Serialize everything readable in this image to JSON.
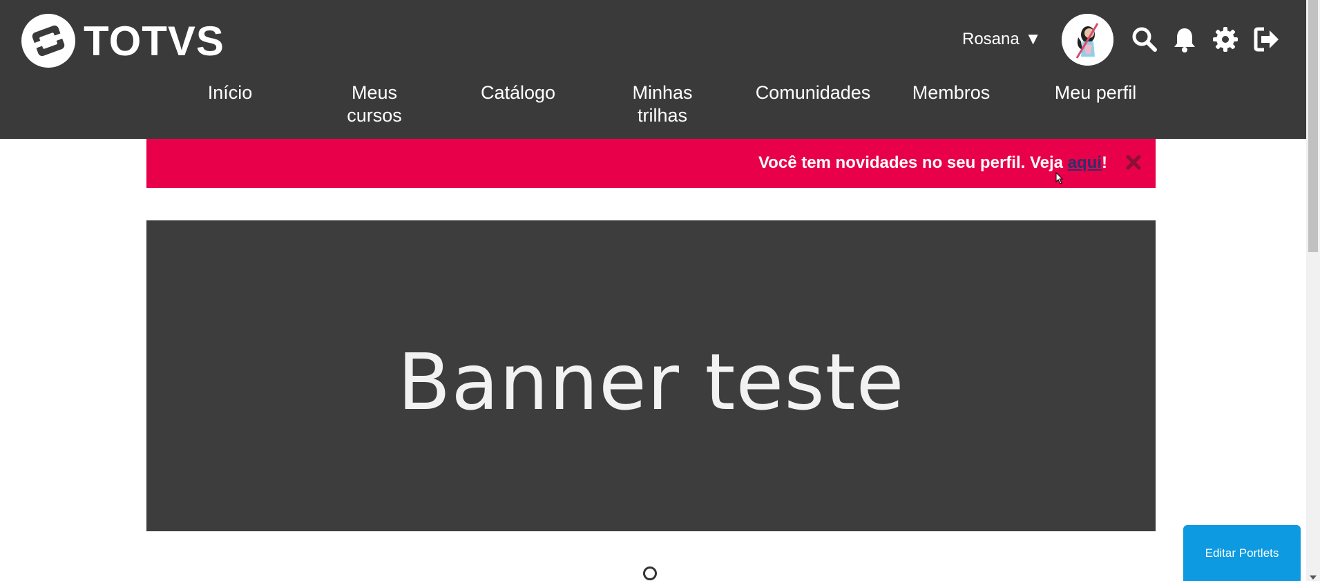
{
  "brand": {
    "logo_text": "TOTVS"
  },
  "header": {
    "user_name": "Rosana",
    "user_caret": "▼",
    "icons": [
      "search-icon",
      "bell-icon",
      "gear-icon",
      "logout-icon"
    ]
  },
  "nav": {
    "items": [
      {
        "label": "Início"
      },
      {
        "label": "Meus cursos"
      },
      {
        "label": "Catálogo"
      },
      {
        "label": "Minhas trilhas"
      },
      {
        "label": "Comunidades"
      },
      {
        "label": "Membros"
      },
      {
        "label": "Meu perfil"
      }
    ]
  },
  "alert": {
    "text": "Você tem novidades no seu perfil. Veja ",
    "link_text": "aqui",
    "suffix": "!"
  },
  "banner": {
    "text": "Banner teste"
  },
  "edit_portlets": {
    "label": "Editar Portlets"
  },
  "colors": {
    "header_bg": "#3a3a3a",
    "alert_bg": "#e8004a",
    "link": "#27336b",
    "button_bg": "#0e9ae0",
    "banner_bg": "#3d3d3d"
  }
}
